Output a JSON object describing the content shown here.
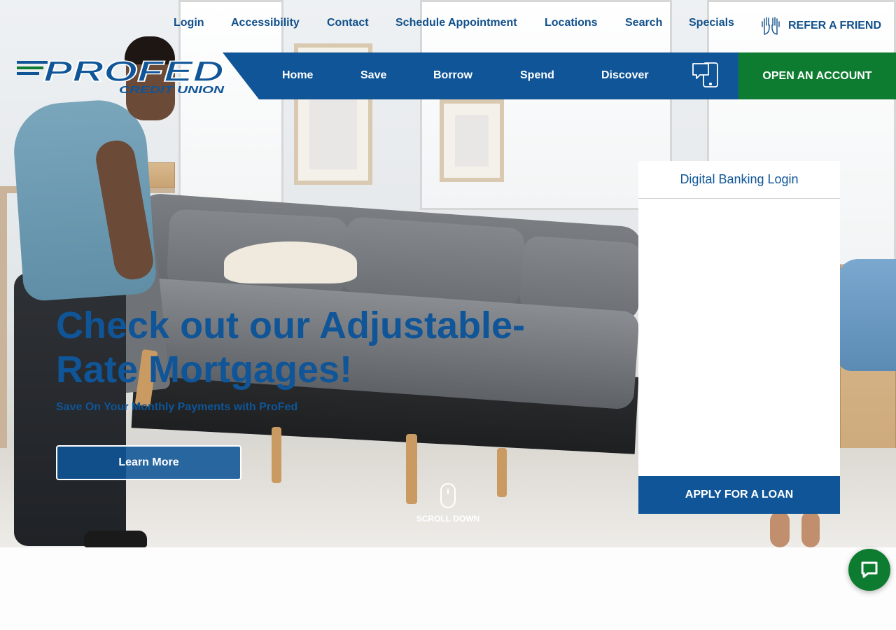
{
  "utility_nav": {
    "items": [
      "Login",
      "Accessibility",
      "Contact",
      "Schedule Appointment",
      "Locations",
      "Search",
      "Specials"
    ],
    "refer_label": "REFER A FRIEND",
    "refer_icon": "high-five-hands-icon"
  },
  "logo": {
    "wordmark": "PROFED",
    "tagline": "CREDIT UNION",
    "colors": {
      "blue": "#0f5597",
      "green": "#0e7c30"
    }
  },
  "main_nav": {
    "items": [
      "Home",
      "Save",
      "Borrow",
      "Spend",
      "Discover"
    ],
    "device_icon": "mobile-chat-icon",
    "cta_label": "OPEN AN ACCOUNT"
  },
  "hero": {
    "headline": "Check out our Adjustable-Rate Mortgages!",
    "subheadline": "Save On Your Monthly Payments with ProFed",
    "button_label": "Learn More",
    "scroll_label": "SCROLL DOWN"
  },
  "login_panel": {
    "title": "Digital Banking Login",
    "apply_label": "APPLY FOR A LOAN"
  },
  "chat": {
    "icon": "chat-bubble-icon"
  },
  "colors": {
    "brand_blue": "#0f5597",
    "brand_green": "#0e7c30",
    "link_blue": "#11508b"
  }
}
